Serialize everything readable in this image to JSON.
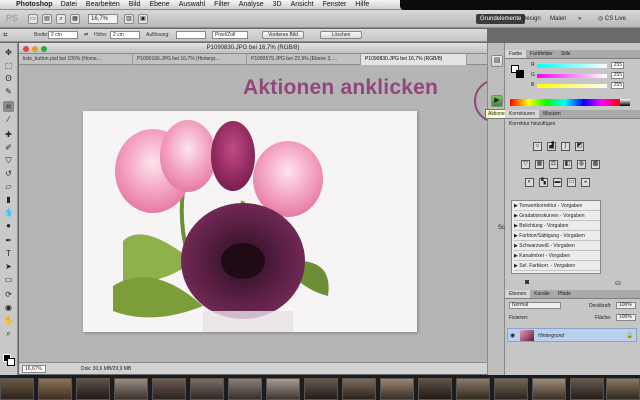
{
  "menubar": {
    "app_name": "Photoshop",
    "items": [
      "Datei",
      "Bearbeiten",
      "Bild",
      "Ebene",
      "Auswahl",
      "Filter",
      "Analyse",
      "3D",
      "Ansicht",
      "Fenster",
      "Hilfe"
    ]
  },
  "appbar": {
    "logo": "PS",
    "zoom": "16,7%",
    "workspaces": [
      "Grundelemente",
      "Design",
      "Malen"
    ],
    "more": "»",
    "cs_live": "CS Live"
  },
  "options": {
    "breite_label": "Breite:",
    "breite_value": "2 cm",
    "hoehe_label": "Höhe:",
    "hoehe_value": "2 cm",
    "aufloesung_label": "Auflösung:",
    "aufloesung_value": "",
    "unit_value": "Pixel/Zoll",
    "vorderes_bild": "Vorderes Bild",
    "loeschen": "Löschen"
  },
  "document": {
    "title": "P1090830.JPG bei 16,7% (RGB/8)",
    "tabs": [
      "liste_button.psd bei 100% (Home,...",
      "P1090166.JPG bei 16,7% (Hintergr...",
      "P1090579.JPG bei 22,9% (Ebene 3, ...",
      "P1090830.JPG bei 16,7% (RGB/8)"
    ],
    "status_zoom": "16,67%",
    "status_doc": "Dok: 30,6 MB/29,9 MB"
  },
  "annotation": {
    "text": "Aktionen anklicken",
    "color": "#93467a"
  },
  "tooltip": "Aktionen",
  "sch_label": "Sch",
  "panels": {
    "color_tabs": [
      "Farbe",
      "Farbfelder",
      "Stile"
    ],
    "color_labels": [
      "R",
      "G",
      "B"
    ],
    "color_values": [
      "255",
      "255",
      "255"
    ],
    "adjust_tabs": [
      "Korrekturen",
      "Masken"
    ],
    "adjust_heading": "Korrektur hinzufügen",
    "presets": [
      "Tonwertkorrektur - Vorgaben",
      "Gradationskurven - Vorgaben",
      "Belichtung - Vorgaben",
      "Farbton/Sättigung - Vorgaben",
      "Schwarzweiß - Vorgaben",
      "Kanalmixer - Vorgaben",
      "Sel. Farbkorr. - Vorgaben"
    ],
    "layer_tabs": [
      "Ebenen",
      "Kanäle",
      "Pfade"
    ],
    "blend_mode": "Normal",
    "opacity_label": "Deckkraft:",
    "opacity_value": "100%",
    "fixieren_label": "Fixieren:",
    "flaeche_label": "Fläche:",
    "flaeche_value": "100%",
    "layer_name": "Hintergrund"
  }
}
